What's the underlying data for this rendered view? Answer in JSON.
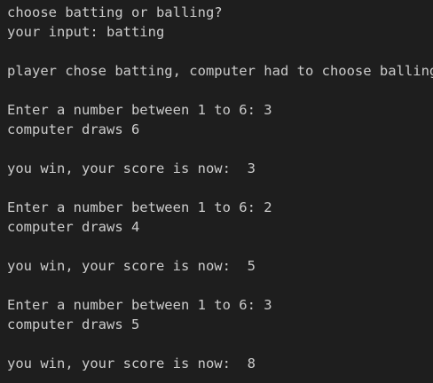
{
  "colors": {
    "background": "#1e1e1e",
    "text": "#cccccc"
  },
  "terminal": {
    "lines": [
      "choose batting or balling?",
      "your input: batting",
      "",
      "player chose batting, computer had to choose balling",
      "",
      "Enter a number between 1 to 6: 3",
      "computer draws 6",
      "",
      "you win, your score is now:  3",
      "",
      "Enter a number between 1 to 6: 2",
      "computer draws 4",
      "",
      "you win, your score is now:  5",
      "",
      "Enter a number between 1 to 6: 3",
      "computer draws 5",
      "",
      "you win, your score is now:  8"
    ]
  }
}
